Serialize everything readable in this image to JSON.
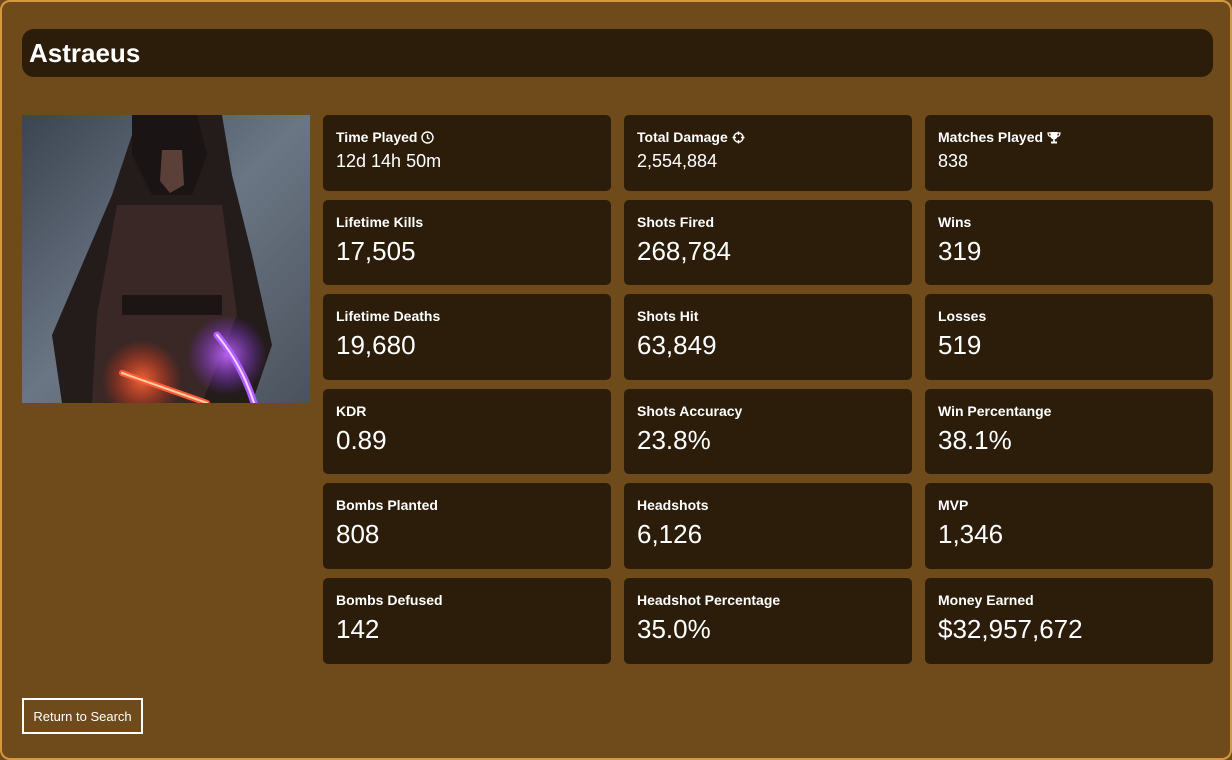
{
  "player": {
    "name": "Astraeus"
  },
  "avatar": {
    "description_icon": "hooded-figure-with-lightsabers"
  },
  "stats": [
    {
      "label": "Time Played",
      "value": "12d 14h 50m",
      "icon": "clock-icon"
    },
    {
      "label": "Total Damage",
      "value": "2,554,884",
      "icon": "crosshair-icon"
    },
    {
      "label": "Matches Played",
      "value": "838",
      "icon": "trophy-icon"
    },
    {
      "label": "Lifetime Kills",
      "value": "17,505"
    },
    {
      "label": "Shots Fired",
      "value": "268,784"
    },
    {
      "label": "Wins",
      "value": "319"
    },
    {
      "label": "Lifetime Deaths",
      "value": "19,680"
    },
    {
      "label": "Shots Hit",
      "value": "63,849"
    },
    {
      "label": "Losses",
      "value": "519"
    },
    {
      "label": "KDR",
      "value": "0.89"
    },
    {
      "label": "Shots Accuracy",
      "value": "23.8%"
    },
    {
      "label": "Win Percentange",
      "value": "38.1%"
    },
    {
      "label": "Bombs Planted",
      "value": "808"
    },
    {
      "label": "Headshots",
      "value": "6,126"
    },
    {
      "label": "MVP",
      "value": "1,346"
    },
    {
      "label": "Bombs Defused",
      "value": "142"
    },
    {
      "label": "Headshot Percentage",
      "value": "35.0%"
    },
    {
      "label": "Money Earned",
      "value": "$32,957,672"
    }
  ],
  "actions": {
    "return_label": "Return to Search"
  },
  "colors": {
    "background": "#6f4a1b",
    "card": "#2b1d0a",
    "border": "#d49a3f"
  }
}
